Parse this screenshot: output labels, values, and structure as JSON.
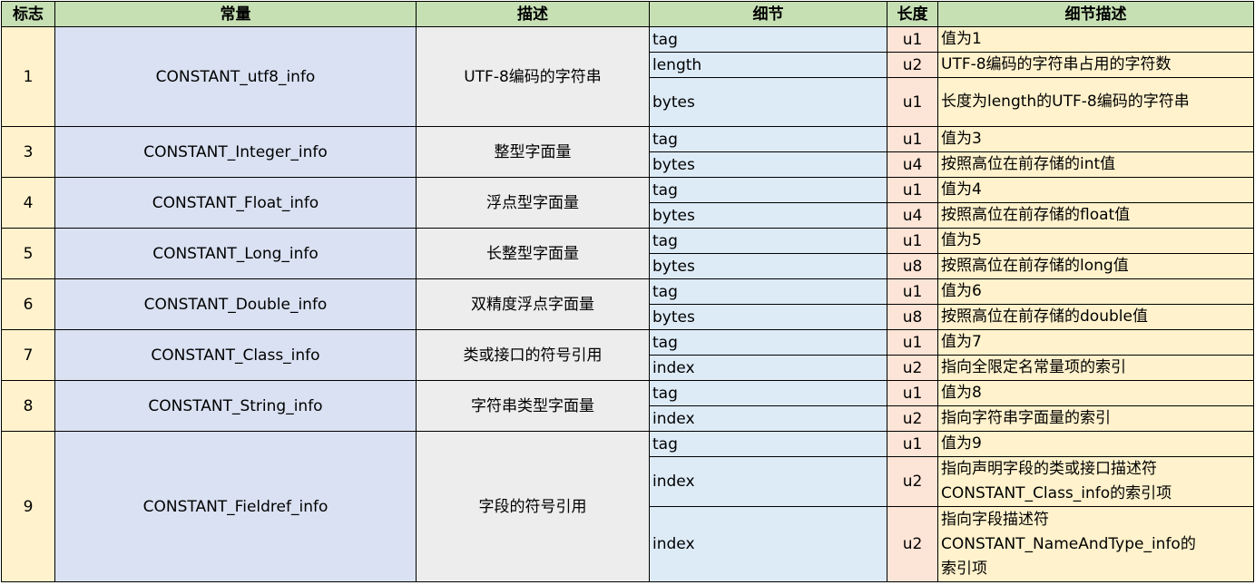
{
  "headers": [
    "标志",
    "常量",
    "描述",
    "细节",
    "长度",
    "细节描述"
  ],
  "colors": {
    "header": "#c6e0b4",
    "flag": "#fff2cc",
    "constant": "#d9e1f2",
    "description": "#ededed",
    "detail": "#ddebf7",
    "length": "#fce4d6",
    "detail_desc": "#fff2cc"
  },
  "rows": [
    {
      "flag": "1",
      "constant": "CONSTANT_utf8_info",
      "description": "UTF-8编码的字符串",
      "items": [
        {
          "detail": "tag",
          "length": "u1",
          "desc": "值为1"
        },
        {
          "detail": "length",
          "length": "u2",
          "desc": "UTF-8编码的字符串占用的字符数"
        },
        {
          "detail": "bytes",
          "length": "u1",
          "desc": "长度为length的UTF-8编码的字符串"
        }
      ]
    },
    {
      "flag": "3",
      "constant": "CONSTANT_Integer_info",
      "description": "整型字面量",
      "items": [
        {
          "detail": "tag",
          "length": "u1",
          "desc": "值为3"
        },
        {
          "detail": "bytes",
          "length": "u4",
          "desc": "按照高位在前存储的int值"
        }
      ]
    },
    {
      "flag": "4",
      "constant": "CONSTANT_Float_info",
      "description": "浮点型字面量",
      "items": [
        {
          "detail": "tag",
          "length": "u1",
          "desc": "值为4"
        },
        {
          "detail": "bytes",
          "length": "u4",
          "desc": "按照高位在前存储的float值"
        }
      ]
    },
    {
      "flag": "5",
      "constant": "CONSTANT_Long_info",
      "description": "长整型字面量",
      "items": [
        {
          "detail": "tag",
          "length": "u1",
          "desc": "值为5"
        },
        {
          "detail": "bytes",
          "length": "u8",
          "desc": "按照高位在前存储的long值"
        }
      ]
    },
    {
      "flag": "6",
      "constant": "CONSTANT_Double_info",
      "description": "双精度浮点字面量",
      "items": [
        {
          "detail": "tag",
          "length": "u1",
          "desc": "值为6"
        },
        {
          "detail": "bytes",
          "length": "u8",
          "desc": "按照高位在前存储的double值"
        }
      ]
    },
    {
      "flag": "7",
      "constant": "CONSTANT_Class_info",
      "description": "类或接口的符号引用",
      "items": [
        {
          "detail": "tag",
          "length": "u1",
          "desc": "值为7"
        },
        {
          "detail": "index",
          "length": "u2",
          "desc": "指向全限定名常量项的索引"
        }
      ]
    },
    {
      "flag": "8",
      "constant": "CONSTANT_String_info",
      "description": "字符串类型字面量",
      "items": [
        {
          "detail": "tag",
          "length": "u1",
          "desc": "值为8"
        },
        {
          "detail": "index",
          "length": "u2",
          "desc": "指向字符串字面量的索引"
        }
      ]
    },
    {
      "flag": "9",
      "constant": "CONSTANT_Fieldref_info",
      "description": "字段的符号引用",
      "items": [
        {
          "detail": "tag",
          "length": "u1",
          "desc": "值为9"
        },
        {
          "detail": "index",
          "length": "u2",
          "desc": "指向声明字段的类或接口描述符\nCONSTANT_Class_info的索引项"
        },
        {
          "detail": "index",
          "length": "u2",
          "desc": "指向字段描述符\nCONSTANT_NameAndType_info的\n索引项"
        }
      ]
    }
  ]
}
